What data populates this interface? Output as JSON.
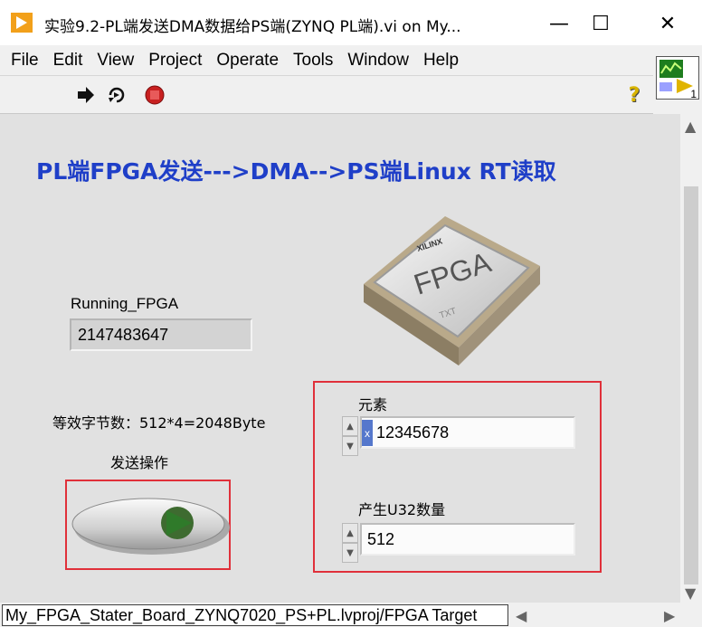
{
  "window": {
    "title": "实验9.2-PL端发送DMA数据给PS端(ZYNQ PL端).vi on My...",
    "minimize_glyph": "—",
    "maximize_glyph": "☐",
    "close_glyph": "✕"
  },
  "menu": [
    "File",
    "Edit",
    "View",
    "Project",
    "Operate",
    "Tools",
    "Window",
    "Help"
  ],
  "toolbar": {
    "icons": [
      "run-arrow-icon",
      "run-continuously-icon",
      "abort-stop-icon"
    ],
    "help_glyph": "?"
  },
  "vi_icon": {
    "badge": "1"
  },
  "panel": {
    "heading": "PL端FPGA发送--->DMA-->PS端Linux RT读取",
    "chip_brand": "XILINX",
    "chip_text": "FPGA",
    "chip_sub": "TXT",
    "running_label": "Running_FPGA",
    "running_value": "2147483647",
    "bytes_note": "等效字节数：512*4=2048Byte",
    "send_label": "发送操作",
    "element_label": "元素",
    "element_value": "12345678",
    "element_radix": "x",
    "count_label": "产生U32数量",
    "count_value": "512"
  },
  "statusbar": {
    "path": "My_FPGA_Stater_Board_ZYNQ7020_PS+PL.lvproj/FPGA Target"
  },
  "colors": {
    "heading": "#1f3fc8",
    "highlight_box": "#e0303a",
    "panel_bg": "#e1e1e1",
    "button_led": "#2f7a2a"
  }
}
